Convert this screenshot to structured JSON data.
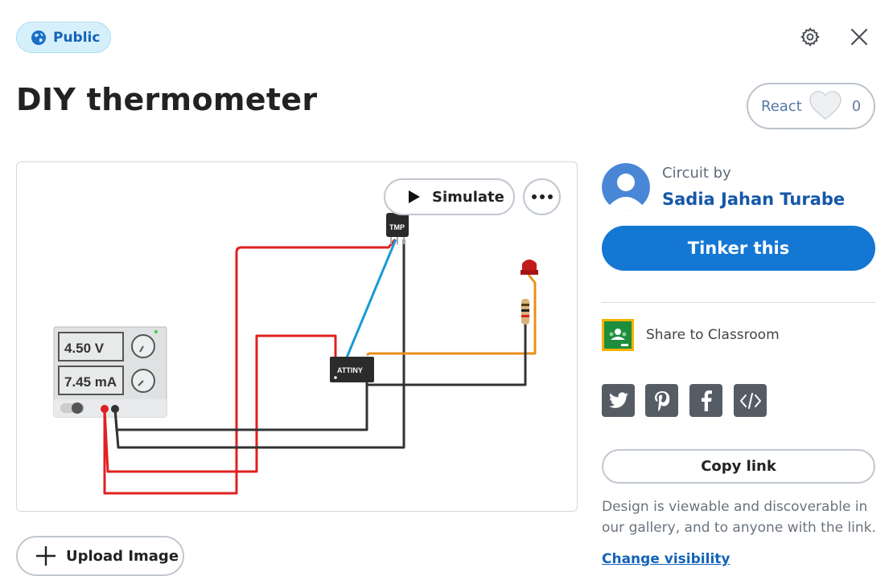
{
  "header": {
    "visibility_label": "Public",
    "settings_icon": "gear-icon",
    "close_icon": "close-icon"
  },
  "design": {
    "title": "DIY thermometer",
    "react_label": "React",
    "react_count": "0"
  },
  "canvas": {
    "simulate_label": "Simulate",
    "more_icon": "more-horizontal-icon",
    "power_supply": {
      "voltage": "4.50 V",
      "current": "7.45 mA"
    },
    "chip_label": "ATTINY",
    "sensor_label": "TMP"
  },
  "upload": {
    "label": "Upload Image"
  },
  "sidebar": {
    "circuit_by": "Circuit by",
    "author": "Sadia Jahan Turabe",
    "tinker_label": "Tinker this",
    "classroom_label": "Share to Classroom",
    "social": [
      "twitter-icon",
      "pinterest-icon",
      "facebook-icon",
      "embed-code-icon"
    ],
    "copy_link_label": "Copy link",
    "visibility_description": "Design is viewable and discoverable in our gallery, and to anyone with the link.",
    "change_visibility_label": "Change visibility"
  },
  "colors": {
    "accent_blue": "#1477d4",
    "link_blue": "#1463b8",
    "public_pill_bg": "#d6f0fb",
    "wire_red": "#e02020",
    "wire_black": "#333333",
    "wire_blue": "#1a9ad6",
    "wire_orange": "#e8901c"
  }
}
